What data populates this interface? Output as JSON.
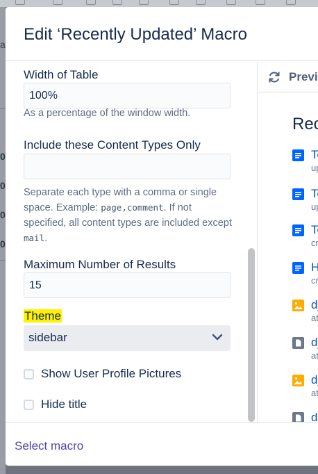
{
  "dialog": {
    "title": "Edit ‘Recently Updated’ Macro"
  },
  "background": {
    "left_marks": [
      "a",
      "0",
      "0",
      "0",
      "0"
    ]
  },
  "form": {
    "width_of_table": {
      "label": "Width of Table",
      "value": "100%",
      "help": "As a percentage of the window width."
    },
    "content_types": {
      "label": "Include these Content Types Only",
      "value": "",
      "help_part1": "Separate each type with a comma or single space. Example: ",
      "help_code1": "page,comment",
      "help_part2": ". If not specified, all content types are included except ",
      "help_code2": "mail",
      "help_part3": "."
    },
    "max_results": {
      "label": "Maximum Number of Results",
      "value": "15"
    },
    "theme": {
      "label": "Theme",
      "selected": "sidebar"
    },
    "show_profile_pictures": {
      "label": "Show User Profile Pictures",
      "checked": false
    },
    "hide_title": {
      "label": "Hide title",
      "checked": false
    }
  },
  "preview": {
    "label": "Previ",
    "title": "Rec",
    "items": [
      {
        "icon": "page-icon",
        "link": "Te",
        "sub": "up",
        "color": "#0065ff"
      },
      {
        "icon": "page-icon",
        "link": "Te",
        "sub": "up",
        "color": "#0065ff"
      },
      {
        "icon": "page-icon",
        "link": "Te",
        "sub": "cr",
        "color": "#0065ff"
      },
      {
        "icon": "page-icon",
        "link": "H",
        "sub": "cr",
        "color": "#0065ff"
      },
      {
        "icon": "image-attachment-icon",
        "link": "d_",
        "sub": "at",
        "color": "#ffab00"
      },
      {
        "icon": "file-attachment-icon",
        "link": "d_",
        "sub": "at",
        "color": "#6b778c"
      },
      {
        "icon": "image-attachment-icon",
        "link": "d_",
        "sub": "at",
        "color": "#ffab00"
      },
      {
        "icon": "file-attachment-icon",
        "link": "d_",
        "sub": "",
        "color": "#6b778c"
      }
    ]
  },
  "footer": {
    "select_macro": "Select macro"
  },
  "colors": {
    "accent": "#0052cc",
    "footer_link": "#5243aa",
    "theme_highlight": "#fff200"
  }
}
